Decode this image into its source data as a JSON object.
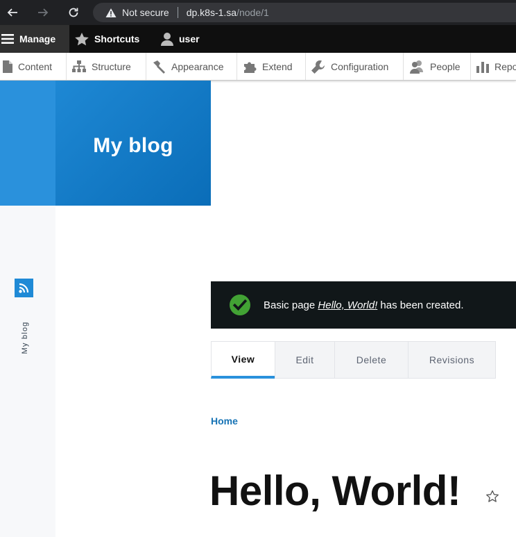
{
  "browser": {
    "security_label": "Not secure",
    "url_host": "dp.k8s-1.sa",
    "url_path": "/node/1"
  },
  "toolbar": {
    "manage_label": "Manage",
    "shortcuts_label": "Shortcuts",
    "user_label": "user"
  },
  "tray": {
    "items": [
      {
        "label": "Content",
        "icon": "document-icon"
      },
      {
        "label": "Structure",
        "icon": "structure-icon"
      },
      {
        "label": "Appearance",
        "icon": "paintbrush-icon"
      },
      {
        "label": "Extend",
        "icon": "puzzle-icon"
      },
      {
        "label": "Configuration",
        "icon": "wrench-icon"
      },
      {
        "label": "People",
        "icon": "people-icon"
      },
      {
        "label": "Repo",
        "icon": "bar-chart-icon"
      }
    ]
  },
  "branding": {
    "site_name": "My blog"
  },
  "sidebar": {
    "label": "My blog",
    "icon": "rss-icon"
  },
  "message": {
    "prefix": "Basic page ",
    "link_text": "Hello, World!",
    "suffix": " has been created.",
    "status": "success"
  },
  "tabs": [
    {
      "label": "View",
      "active": true
    },
    {
      "label": "Edit",
      "active": false
    },
    {
      "label": "Delete",
      "active": false
    },
    {
      "label": "Revisions",
      "active": false
    }
  ],
  "breadcrumb": {
    "home_label": "Home"
  },
  "page": {
    "title": "Hello, World!"
  },
  "colors": {
    "accent": "#2a91dc",
    "toolbar_bg": "#0f0f0f",
    "message_bg": "#111719",
    "success": "#42a234",
    "link": "#1673b5"
  }
}
